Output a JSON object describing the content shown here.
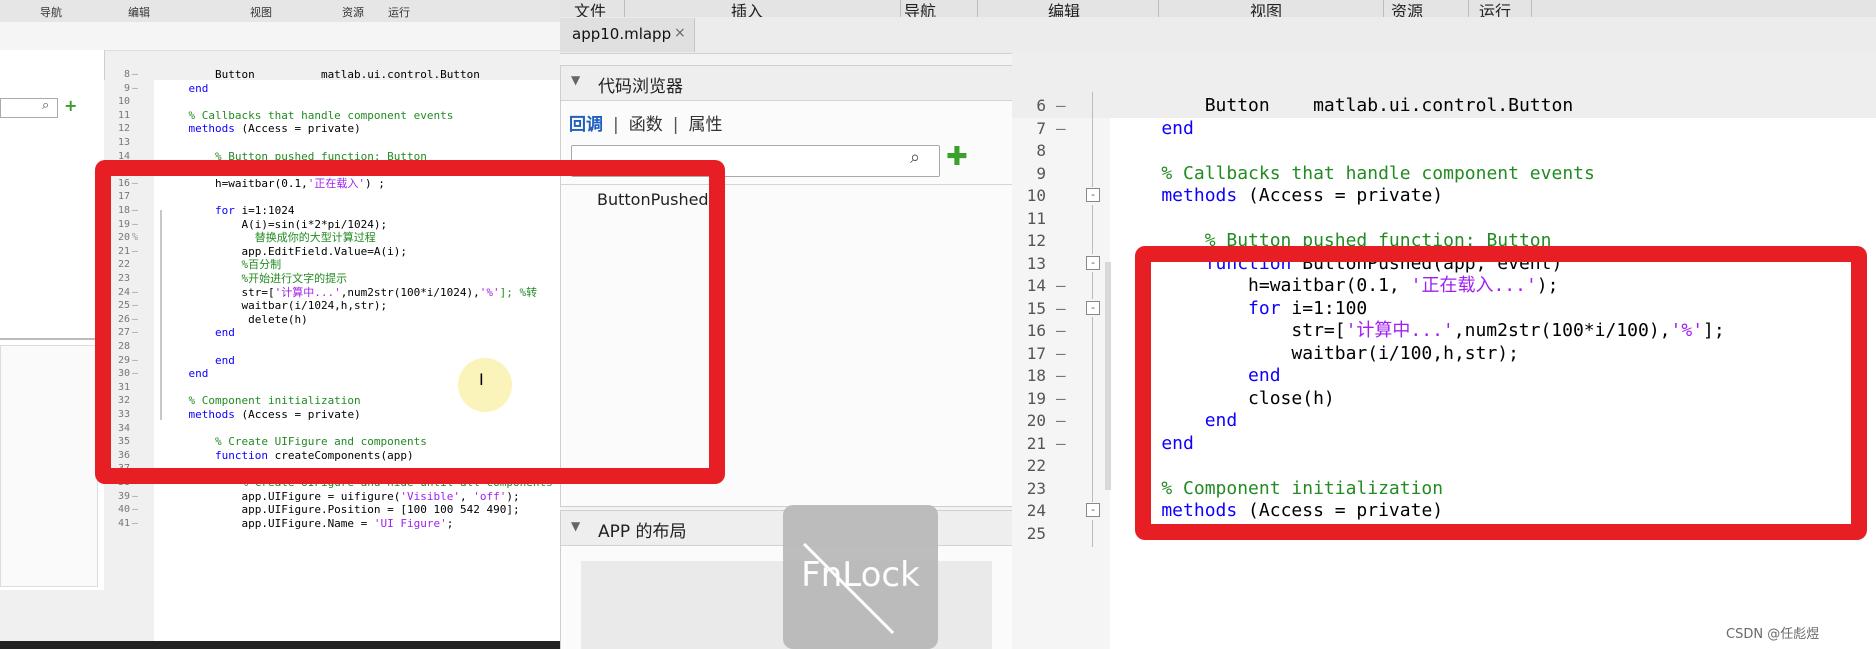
{
  "left_window": {
    "menu": [
      "导航",
      "编辑",
      "视图",
      "资源",
      "运行"
    ],
    "code_lines": [
      {
        "n": "8",
        "d": "–",
        "parts": [
          {
            "t": "        Button          matlab.ui.control.Button",
            "c": "t"
          }
        ]
      },
      {
        "n": "9",
        "d": "–",
        "parts": [
          {
            "t": "    end",
            "c": "k"
          }
        ]
      },
      {
        "n": "10",
        "d": "",
        "parts": [
          {
            "t": "",
            "c": "t"
          }
        ]
      },
      {
        "n": "11",
        "d": "",
        "parts": [
          {
            "t": "    % Callbacks that handle component events",
            "c": "c"
          }
        ]
      },
      {
        "n": "12",
        "d": "",
        "parts": [
          {
            "t": "    methods",
            "c": "k"
          },
          {
            "t": " (Access = private)",
            "c": "t"
          }
        ]
      },
      {
        "n": "13",
        "d": "",
        "parts": [
          {
            "t": "",
            "c": "t"
          }
        ]
      },
      {
        "n": "14",
        "d": "",
        "parts": [
          {
            "t": "        % Button pushed function: Button",
            "c": "c"
          }
        ]
      },
      {
        "n": "15",
        "d": "",
        "parts": [
          {
            "t": "        function",
            "c": "k"
          },
          {
            "t": " ButtonPushed(app, event)",
            "c": "t"
          }
        ]
      },
      {
        "n": "16",
        "d": "–",
        "parts": [
          {
            "t": "        h=waitbar(0.1,",
            "c": "t"
          },
          {
            "t": "'正在载入'",
            "c": "s"
          },
          {
            "t": ") ;",
            "c": "t"
          }
        ]
      },
      {
        "n": "17",
        "d": "",
        "parts": [
          {
            "t": "",
            "c": "t"
          }
        ]
      },
      {
        "n": "18",
        "d": "–",
        "parts": [
          {
            "t": "        for",
            "c": "k"
          },
          {
            "t": " i=1:1024",
            "c": "t"
          }
        ]
      },
      {
        "n": "19",
        "d": "–",
        "parts": [
          {
            "t": "            A(i)=sin(i*2*pi/1024);",
            "c": "t"
          }
        ]
      },
      {
        "n": "20",
        "d": "%",
        "parts": [
          {
            "t": "              替换成你的大型计算过程",
            "c": "c"
          }
        ]
      },
      {
        "n": "21",
        "d": "–",
        "parts": [
          {
            "t": "            app.EditField.Value=A(i);",
            "c": "t"
          }
        ]
      },
      {
        "n": "22",
        "d": "",
        "parts": [
          {
            "t": "            %百分制",
            "c": "c"
          }
        ]
      },
      {
        "n": "23",
        "d": "",
        "parts": [
          {
            "t": "            %开始进行文字的提示",
            "c": "c"
          }
        ]
      },
      {
        "n": "24",
        "d": "–",
        "parts": [
          {
            "t": "            str=[",
            "c": "t"
          },
          {
            "t": "'计算中...'",
            "c": "s"
          },
          {
            "t": ",num2str(100*i/1024),",
            "c": "t"
          },
          {
            "t": "'%'",
            "c": "s"
          },
          {
            "t": "]; %转",
            "c": "c"
          }
        ]
      },
      {
        "n": "25",
        "d": "–",
        "parts": [
          {
            "t": "            waitbar(i/1024,h,str);",
            "c": "t"
          }
        ]
      },
      {
        "n": "26",
        "d": "–",
        "parts": [
          {
            "t": "             delete(h)",
            "c": "t"
          }
        ]
      },
      {
        "n": "27",
        "d": "–",
        "parts": [
          {
            "t": "        end",
            "c": "k"
          }
        ]
      },
      {
        "n": "28",
        "d": "",
        "parts": [
          {
            "t": "",
            "c": "t"
          }
        ]
      },
      {
        "n": "29",
        "d": "–",
        "parts": [
          {
            "t": "        end",
            "c": "k"
          }
        ]
      },
      {
        "n": "30",
        "d": "–",
        "parts": [
          {
            "t": "    end",
            "c": "k"
          }
        ]
      },
      {
        "n": "31",
        "d": "",
        "parts": [
          {
            "t": "",
            "c": "t"
          }
        ]
      },
      {
        "n": "32",
        "d": "",
        "parts": [
          {
            "t": "    % Component initialization",
            "c": "c"
          }
        ]
      },
      {
        "n": "33",
        "d": "",
        "parts": [
          {
            "t": "    methods",
            "c": "k"
          },
          {
            "t": " (Access = private)",
            "c": "t"
          }
        ]
      },
      {
        "n": "34",
        "d": "",
        "parts": [
          {
            "t": "",
            "c": "t"
          }
        ]
      },
      {
        "n": "35",
        "d": "",
        "parts": [
          {
            "t": "        % Create UIFigure and components",
            "c": "c"
          }
        ]
      },
      {
        "n": "36",
        "d": "",
        "parts": [
          {
            "t": "        function",
            "c": "k"
          },
          {
            "t": " createComponents(app)",
            "c": "t"
          }
        ]
      },
      {
        "n": "37",
        "d": "",
        "parts": [
          {
            "t": "",
            "c": "t"
          }
        ]
      },
      {
        "n": "38",
        "d": "",
        "parts": [
          {
            "t": "            % Create UIFigure and hide until all components",
            "c": "c"
          }
        ]
      },
      {
        "n": "39",
        "d": "–",
        "parts": [
          {
            "t": "            app.UIFigure = uifigure(",
            "c": "t"
          },
          {
            "t": "'Visible'",
            "c": "s"
          },
          {
            "t": ", ",
            "c": "t"
          },
          {
            "t": "'off'",
            "c": "s"
          },
          {
            "t": ");",
            "c": "t"
          }
        ]
      },
      {
        "n": "40",
        "d": "–",
        "parts": [
          {
            "t": "            app.UIFigure.Position = [100 100 542 490];",
            "c": "t"
          }
        ]
      },
      {
        "n": "41",
        "d": "–",
        "parts": [
          {
            "t": "            app.UIFigure.Name = ",
            "c": "t"
          },
          {
            "t": "'UI Figure'",
            "c": "s"
          },
          {
            "t": ";",
            "c": "t"
          }
        ]
      }
    ]
  },
  "menu": [
    "文件",
    "插入",
    "导航",
    "编辑",
    "视图",
    "资源",
    "运行"
  ],
  "file_tab": {
    "label": "app10.mlapp",
    "close": "×"
  },
  "code_browser": {
    "title": "代码浏览器",
    "tabs": [
      "回调",
      "函数",
      "属性"
    ],
    "active_tab": "回调",
    "search_placeholder": "",
    "items": [
      "ButtonPushed"
    ]
  },
  "layout_panel": {
    "title": "APP 的布局"
  },
  "overlay": {
    "fnlock_label": "FnLock"
  },
  "editor": {
    "lines": [
      {
        "n": "6",
        "d": "–",
        "fold": "",
        "parts": [
          {
            "t": "        Button    matlab.ui.control.Button",
            "c": "t"
          }
        ]
      },
      {
        "n": "7",
        "d": "–",
        "fold": "",
        "parts": [
          {
            "t": "    end",
            "c": "k"
          }
        ]
      },
      {
        "n": "8",
        "d": "",
        "fold": "",
        "parts": [
          {
            "t": "",
            "c": "t"
          }
        ]
      },
      {
        "n": "9",
        "d": "",
        "fold": "",
        "parts": [
          {
            "t": "    % Callbacks that handle component events",
            "c": "c"
          }
        ]
      },
      {
        "n": "10",
        "d": "",
        "fold": "-",
        "parts": [
          {
            "t": "    methods",
            "c": "k"
          },
          {
            "t": " (Access = private)",
            "c": "t"
          }
        ]
      },
      {
        "n": "11",
        "d": "",
        "fold": "",
        "parts": [
          {
            "t": "",
            "c": "t"
          }
        ]
      },
      {
        "n": "12",
        "d": "",
        "fold": "",
        "parts": [
          {
            "t": "        % Button pushed function: Button",
            "c": "c"
          }
        ]
      },
      {
        "n": "13",
        "d": "",
        "fold": "-",
        "parts": [
          {
            "t": "        function",
            "c": "k"
          },
          {
            "t": " ButtonPushed(app, event)",
            "c": "t"
          }
        ]
      },
      {
        "n": "14",
        "d": "–",
        "fold": "",
        "parts": [
          {
            "t": "            h=waitbar(0.1, ",
            "c": "t"
          },
          {
            "t": "'正在载入...'",
            "c": "s"
          },
          {
            "t": ");",
            "c": "t"
          }
        ]
      },
      {
        "n": "15",
        "d": "–",
        "fold": "-",
        "parts": [
          {
            "t": "            for",
            "c": "k"
          },
          {
            "t": " i=1:100",
            "c": "t"
          }
        ]
      },
      {
        "n": "16",
        "d": "–",
        "fold": "",
        "parts": [
          {
            "t": "                str=[",
            "c": "t"
          },
          {
            "t": "'计算中...'",
            "c": "s"
          },
          {
            "t": ",num2str(100*i/100),",
            "c": "t"
          },
          {
            "t": "'%'",
            "c": "s"
          },
          {
            "t": "];",
            "c": "t"
          }
        ]
      },
      {
        "n": "17",
        "d": "–",
        "fold": "",
        "parts": [
          {
            "t": "                waitbar(i/100,h,str);",
            "c": "t"
          }
        ]
      },
      {
        "n": "18",
        "d": "–",
        "fold": "",
        "parts": [
          {
            "t": "            end",
            "c": "k"
          }
        ]
      },
      {
        "n": "19",
        "d": "–",
        "fold": "",
        "parts": [
          {
            "t": "            close(h)",
            "c": "t"
          }
        ]
      },
      {
        "n": "20",
        "d": "–",
        "fold": "",
        "parts": [
          {
            "t": "        end",
            "c": "k"
          }
        ]
      },
      {
        "n": "21",
        "d": "–",
        "fold": "",
        "parts": [
          {
            "t": "    end",
            "c": "k"
          }
        ]
      },
      {
        "n": "22",
        "d": "",
        "fold": "",
        "parts": [
          {
            "t": "",
            "c": "t"
          }
        ]
      },
      {
        "n": "23",
        "d": "",
        "fold": "",
        "parts": [
          {
            "t": "    % Component initialization",
            "c": "c"
          }
        ]
      },
      {
        "n": "24",
        "d": "",
        "fold": "-",
        "parts": [
          {
            "t": "    methods",
            "c": "k"
          },
          {
            "t": " (Access = private)",
            "c": "t"
          }
        ]
      },
      {
        "n": "25",
        "d": "",
        "fold": "",
        "parts": [
          {
            "t": "",
            "c": "t"
          }
        ]
      }
    ]
  },
  "annotation_color": "#e81e25",
  "watermark": "CSDN @任彪煜"
}
